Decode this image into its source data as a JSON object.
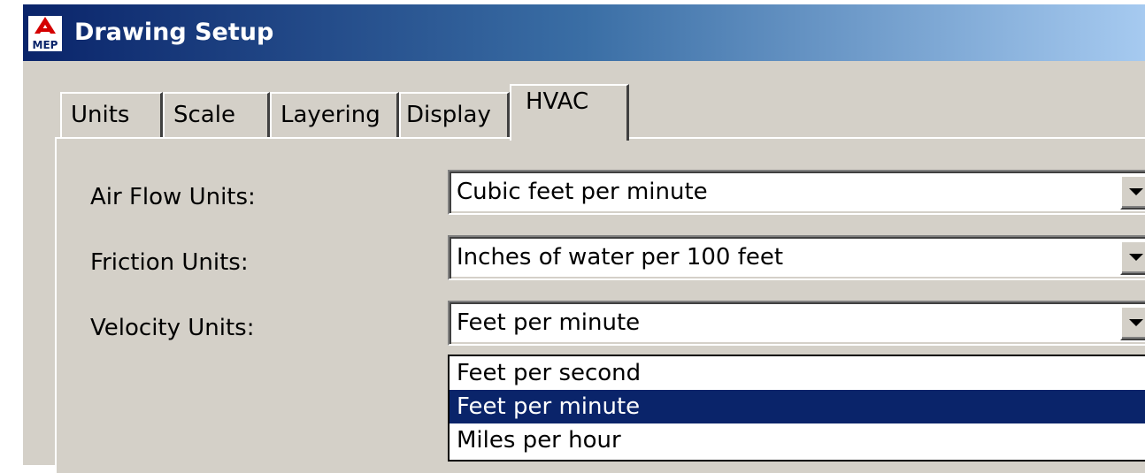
{
  "window": {
    "title": "Drawing Setup",
    "icon": {
      "name": "autocad-mep-icon",
      "text": "MEP"
    },
    "colors": {
      "titlebar_start": "#0a246a",
      "titlebar_end": "#a6caf0",
      "face": "#d4d0c8",
      "selection": "#0a246a"
    }
  },
  "tabs": [
    {
      "label": "Units"
    },
    {
      "label": "Scale"
    },
    {
      "label": "Layering"
    },
    {
      "label": "Display"
    },
    {
      "label": "HVAC",
      "active": true
    }
  ],
  "hvac": {
    "air_flow": {
      "label": "Air Flow Units:",
      "value": "Cubic feet per minute"
    },
    "friction": {
      "label": "Friction Units:",
      "value": "Inches of water per 100 feet"
    },
    "velocity": {
      "label": "Velocity Units:",
      "value": "Feet per minute",
      "options": [
        "Feet per second",
        "Feet per minute",
        "Miles per hour"
      ],
      "selected_option": "Feet per minute",
      "expanded": true
    }
  }
}
